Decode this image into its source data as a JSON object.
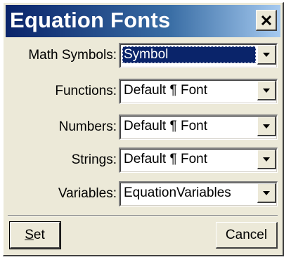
{
  "window": {
    "title": "Equation Fonts",
    "close_label": "×"
  },
  "colors": {
    "title_bar_start": "#0a246a",
    "title_bar_end": "#a6caf0",
    "dialog_face": "#ece9d8",
    "selection": "#0a246a"
  },
  "fields": [
    {
      "label": "Math Symbols:",
      "value": "Symbol",
      "selected": true
    },
    {
      "label": "Functions:",
      "value": "Default ¶ Font",
      "selected": false
    },
    {
      "label": "Numbers:",
      "value": "Default ¶ Font",
      "selected": false
    },
    {
      "label": "Strings:",
      "value": "Default ¶ Font",
      "selected": false
    },
    {
      "label": "Variables:",
      "value": "EquationVariables",
      "selected": false
    }
  ],
  "buttons": {
    "set_label": "Set",
    "cancel_label": "Cancel"
  },
  "icons": {
    "close": "close-icon",
    "dropdown": "chevron-down-icon"
  }
}
